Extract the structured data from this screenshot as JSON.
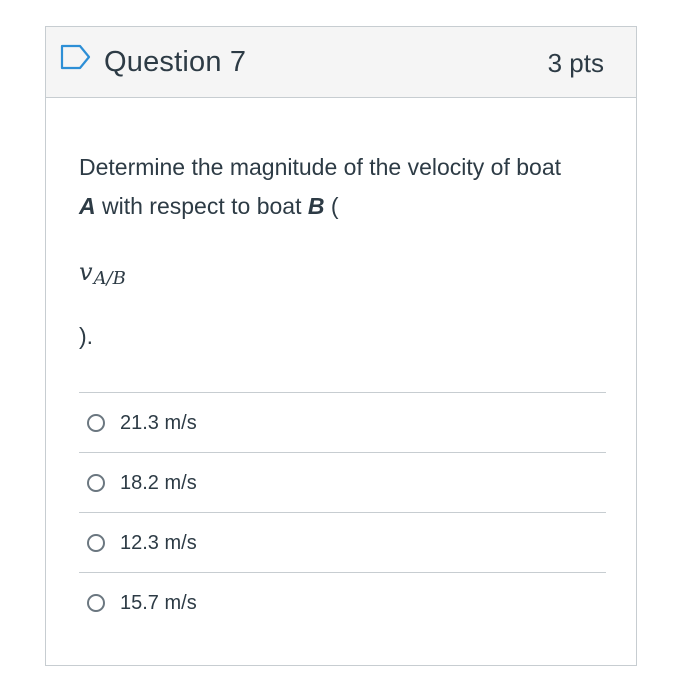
{
  "question": {
    "title": "Question 7",
    "points": "3 pts",
    "prompt_part1": "Determine the magnitude of the velocity of boat ",
    "bold_a": "A",
    "prompt_part2": " with respect to boat ",
    "bold_b": "B",
    "prompt_part3": " (",
    "math_symbol": "v",
    "math_subscript": "A/B",
    "closing": ")."
  },
  "answers": [
    {
      "label": "21.3 m/s",
      "selected": false
    },
    {
      "label": "18.2 m/s",
      "selected": false
    },
    {
      "label": "12.3 m/s",
      "selected": false
    },
    {
      "label": "15.7 m/s",
      "selected": false
    }
  ],
  "icons": {
    "flag": "bookmark-flag-icon"
  },
  "colors": {
    "accent": "#2d8fd6",
    "text": "#2d3b45",
    "border": "#c7cdd1",
    "header_bg": "#f5f5f5"
  }
}
